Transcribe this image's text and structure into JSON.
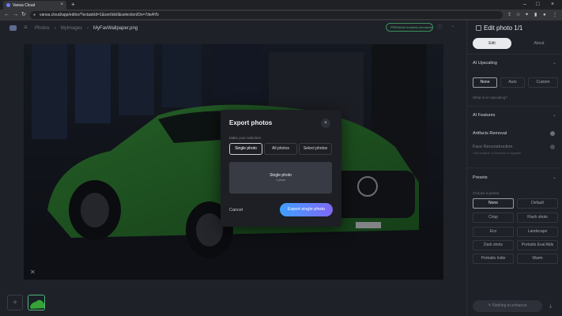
{
  "browser": {
    "tab_title": "Vansa Cloud",
    "tab_close": "×",
    "new_tab": "+",
    "url": "vansa.cloud/app/editor/?ectaskId=1&sortIdx0&selectionIDs=7deAYb",
    "win_controls": [
      "–",
      "□",
      "×"
    ],
    "nav": [
      "←",
      "→",
      "↻"
    ]
  },
  "header": {
    "breadcrumbs": [
      "Photos",
      "Mylmages",
      "MyFavWallpaper.png"
    ],
    "plan_badge": "PREMIUM enabled (remaining)"
  },
  "panel": {
    "title": "Edit photo 1/1",
    "tabs": [
      "Edit",
      "About"
    ],
    "ai_upscaling": {
      "label": "AI Upscaling",
      "options": [
        "None",
        "Auto",
        "Custom"
      ],
      "selected": "None",
      "link": "What is AI Upscaling?"
    },
    "ai_features": {
      "label": "AI Features",
      "artifacts": "Artifacts Removal",
      "face": "Face Reconstruction",
      "face_sub": "Only available in Enterprise or Upgrade"
    },
    "presets": {
      "label": "Presets",
      "hint": "Choose a preset",
      "options": [
        "None",
        "Default",
        "Crisp",
        "Flash shots",
        "Eco",
        "Landscape",
        "Dark shots",
        "Portraits Eval Alds",
        "Portraits Indie",
        "Warm"
      ],
      "selected": "None"
    },
    "enhance_button": "Nothing to enhance"
  },
  "modal": {
    "title": "Export photos",
    "close": "×",
    "hint": "Make your selection",
    "options": [
      "Single photo",
      "All photos",
      "Select photos"
    ],
    "selected": "Single photo",
    "card_title": "Single photo",
    "card_sub": "1 photo",
    "cancel": "Cancel",
    "export": "Export single photo"
  },
  "colors": {
    "accent_start": "#3fa0ff",
    "accent_end": "#7f68f5",
    "premium_green": "#4fb879"
  }
}
